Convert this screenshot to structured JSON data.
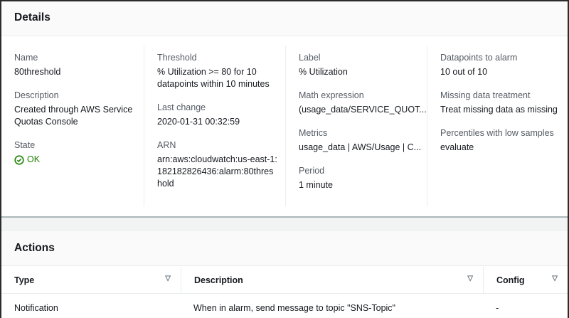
{
  "details": {
    "title": "Details",
    "columns": [
      [
        {
          "label": "Name",
          "value": "80threshold"
        },
        {
          "label": "Description",
          "value": "Created through AWS Service Quotas Console"
        },
        {
          "label": "State",
          "value": "OK"
        }
      ],
      [
        {
          "label": "Threshold",
          "value": "% Utilization >= 80 for 10 datapoints within 10 minutes"
        },
        {
          "label": "Last change",
          "value": "2020-01-31 00:32:59"
        },
        {
          "label": "ARN",
          "value": "arn:aws:cloudwatch:us-east-1:182182826436:alarm:80threshold"
        }
      ],
      [
        {
          "label": "Label",
          "value": "% Utilization"
        },
        {
          "label": "Math expression",
          "value": "(usage_data/SERVICE_QUOT..."
        },
        {
          "label": "Metrics",
          "value": "usage_data | AWS/Usage | C..."
        },
        {
          "label": "Period",
          "value": "1 minute"
        }
      ],
      [
        {
          "label": "Datapoints to alarm",
          "value": "10 out of 10"
        },
        {
          "label": "Missing data treatment",
          "value": "Treat missing data as missing"
        },
        {
          "label": "Percentiles with low samples",
          "value": "evaluate"
        }
      ]
    ]
  },
  "actions": {
    "title": "Actions",
    "headers": [
      "Type",
      "Description",
      "Config"
    ],
    "rows": [
      [
        "Notification",
        "When in alarm, send message to topic \"SNS-Topic\"",
        "-"
      ]
    ]
  },
  "colors": {
    "ok": "#1d8102"
  }
}
